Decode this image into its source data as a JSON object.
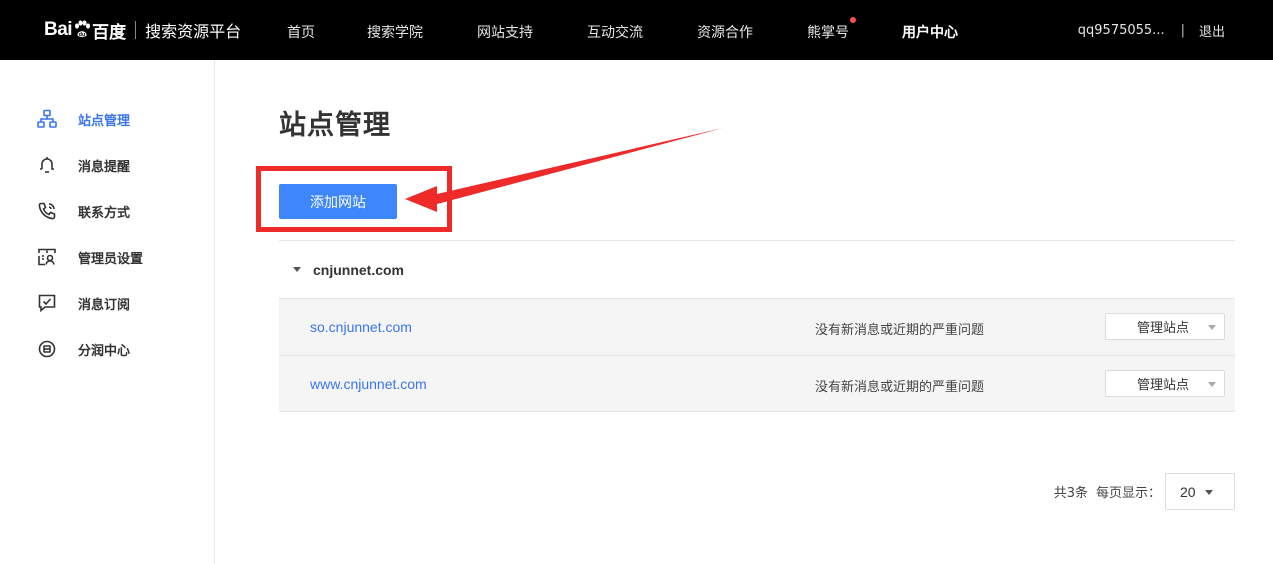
{
  "brand": {
    "logo_bai": "Bai",
    "logo_cn": "百度",
    "platform": "搜索资源平台"
  },
  "nav": {
    "items": [
      {
        "label": "首页"
      },
      {
        "label": "搜索学院"
      },
      {
        "label": "网站支持"
      },
      {
        "label": "互动交流"
      },
      {
        "label": "资源合作"
      },
      {
        "label": "熊掌号",
        "has_dot": true
      },
      {
        "label": "用户中心",
        "active": true
      }
    ],
    "user_name": "qq9575055...",
    "separator": "|",
    "logout": "退出"
  },
  "sidebar": {
    "items": [
      {
        "label": "站点管理",
        "icon": "sitemap-icon",
        "active": true
      },
      {
        "label": "消息提醒",
        "icon": "bell-icon"
      },
      {
        "label": "联系方式",
        "icon": "phone-icon"
      },
      {
        "label": "管理员设置",
        "icon": "admin-icon"
      },
      {
        "label": "消息订阅",
        "icon": "subscribe-check-icon"
      },
      {
        "label": "分润中心",
        "icon": "coin-icon"
      }
    ]
  },
  "main": {
    "title": "站点管理",
    "add_button": "添加网站",
    "group": {
      "domain": "cnjunnet.com",
      "sites": [
        {
          "domain": "so.cnjunnet.com",
          "message": "没有新消息或近期的严重问题",
          "action": "管理站点"
        },
        {
          "domain": "www.cnjunnet.com",
          "message": "没有新消息或近期的严重问题",
          "action": "管理站点"
        }
      ]
    },
    "pager": {
      "total": "共3条",
      "per_page_label": "每页显示：",
      "per_page_value": "20"
    }
  },
  "colors": {
    "topbar_bg": "#000000",
    "accent_blue": "#3d87fb",
    "link_blue": "#3a74f0",
    "annotation_red": "#ee2a2a",
    "notify_dot": "#ff4d4f"
  }
}
